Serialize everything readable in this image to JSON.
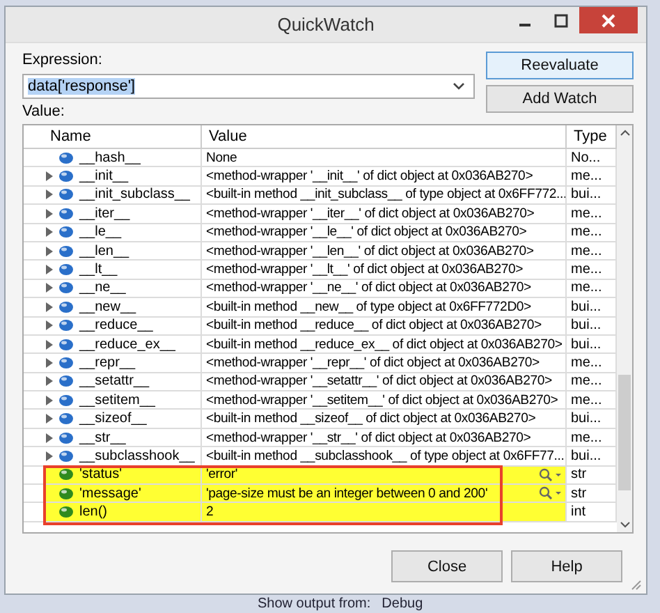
{
  "backdrop": {
    "bottom_texts": [
      "Show output from:",
      "Debug"
    ]
  },
  "window": {
    "title": "QuickWatch"
  },
  "expression": {
    "label": "Expression:",
    "value": "data['response']"
  },
  "value_label": "Value:",
  "buttons_side": [
    "Reevaluate",
    "Add Watch"
  ],
  "table": {
    "columns": [
      "Name",
      "Value",
      "Type"
    ],
    "rows": [
      {
        "kind": "attribute",
        "expandable": false,
        "highlighted": false,
        "visualizer": false,
        "name": "__hash__",
        "value": "None",
        "type": "No..."
      },
      {
        "kind": "attribute",
        "expandable": true,
        "highlighted": false,
        "visualizer": false,
        "name": "__init__",
        "value": "<method-wrapper '__init__' of dict object at 0x036AB270>",
        "type": "me..."
      },
      {
        "kind": "attribute",
        "expandable": true,
        "highlighted": false,
        "visualizer": false,
        "name": "__init_subclass__",
        "value": "<built-in method __init_subclass__ of type object at 0x6FF772...",
        "type": "bui..."
      },
      {
        "kind": "attribute",
        "expandable": true,
        "highlighted": false,
        "visualizer": false,
        "name": "__iter__",
        "value": "<method-wrapper '__iter__' of dict object at 0x036AB270>",
        "type": "me..."
      },
      {
        "kind": "attribute",
        "expandable": true,
        "highlighted": false,
        "visualizer": false,
        "name": "__le__",
        "value": "<method-wrapper '__le__' of dict object at 0x036AB270>",
        "type": "me..."
      },
      {
        "kind": "attribute",
        "expandable": true,
        "highlighted": false,
        "visualizer": false,
        "name": "__len__",
        "value": "<method-wrapper '__len__' of dict object at 0x036AB270>",
        "type": "me..."
      },
      {
        "kind": "attribute",
        "expandable": true,
        "highlighted": false,
        "visualizer": false,
        "name": "__lt__",
        "value": "<method-wrapper '__lt__' of dict object at 0x036AB270>",
        "type": "me..."
      },
      {
        "kind": "attribute",
        "expandable": true,
        "highlighted": false,
        "visualizer": false,
        "name": "__ne__",
        "value": "<method-wrapper '__ne__' of dict object at 0x036AB270>",
        "type": "me..."
      },
      {
        "kind": "attribute",
        "expandable": true,
        "highlighted": false,
        "visualizer": false,
        "name": "__new__",
        "value": "<built-in method __new__ of type object at 0x6FF772D0>",
        "type": "bui..."
      },
      {
        "kind": "attribute",
        "expandable": true,
        "highlighted": false,
        "visualizer": false,
        "name": "__reduce__",
        "value": "<built-in method __reduce__ of dict object at 0x036AB270>",
        "type": "bui..."
      },
      {
        "kind": "attribute",
        "expandable": true,
        "highlighted": false,
        "visualizer": false,
        "name": "__reduce_ex__",
        "value": "<built-in method __reduce_ex__ of dict object at 0x036AB270>",
        "type": "bui..."
      },
      {
        "kind": "attribute",
        "expandable": true,
        "highlighted": false,
        "visualizer": false,
        "name": "__repr__",
        "value": "<method-wrapper '__repr__' of dict object at 0x036AB270>",
        "type": "me..."
      },
      {
        "kind": "attribute",
        "expandable": true,
        "highlighted": false,
        "visualizer": false,
        "name": "__setattr__",
        "value": "<method-wrapper '__setattr__' of dict object at 0x036AB270>",
        "type": "me..."
      },
      {
        "kind": "attribute",
        "expandable": true,
        "highlighted": false,
        "visualizer": false,
        "name": "__setitem__",
        "value": "<method-wrapper '__setitem__' of dict object at 0x036AB270>",
        "type": "me..."
      },
      {
        "kind": "attribute",
        "expandable": true,
        "highlighted": false,
        "visualizer": false,
        "name": "__sizeof__",
        "value": "<built-in method __sizeof__ of dict object at 0x036AB270>",
        "type": "bui..."
      },
      {
        "kind": "attribute",
        "expandable": true,
        "highlighted": false,
        "visualizer": false,
        "name": "__str__",
        "value": "<method-wrapper '__str__' of dict object at 0x036AB270>",
        "type": "me..."
      },
      {
        "kind": "attribute",
        "expandable": true,
        "highlighted": false,
        "visualizer": false,
        "name": "__subclasshook__",
        "value": "<built-in method __subclasshook__ of type object at 0x6FF77...",
        "type": "bui..."
      },
      {
        "kind": "item",
        "expandable": false,
        "highlighted": true,
        "visualizer": true,
        "name": "'status'",
        "value": "'error'",
        "type": "str"
      },
      {
        "kind": "item",
        "expandable": false,
        "highlighted": true,
        "visualizer": true,
        "name": "'message'",
        "value": "'page-size must be an integer between 0 and 200'",
        "type": "str"
      },
      {
        "kind": "item",
        "expandable": false,
        "highlighted": true,
        "visualizer": false,
        "name": "len()",
        "value": "2",
        "type": "int"
      }
    ]
  },
  "buttons_bottom": [
    "Close",
    "Help"
  ]
}
